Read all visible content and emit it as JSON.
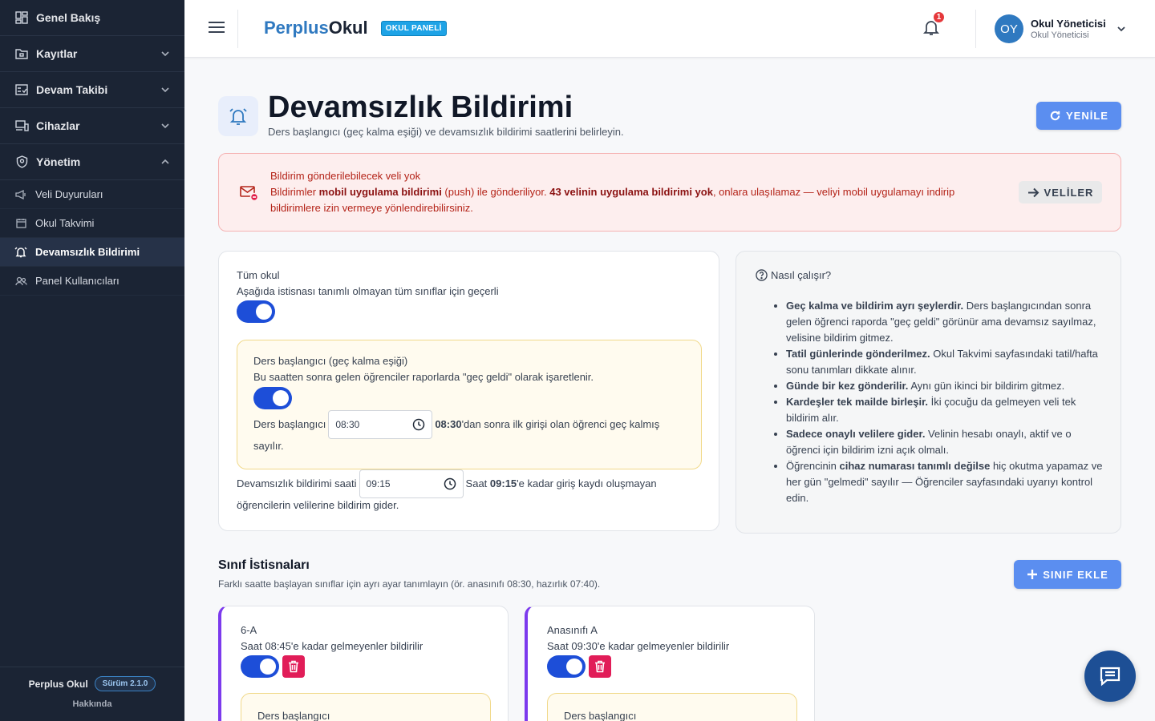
{
  "sidebar": {
    "items": [
      {
        "label": "Genel Bakış",
        "icon": "dashboard-icon"
      },
      {
        "label": "Kayıtlar",
        "icon": "folder-icon"
      },
      {
        "label": "Devam Takibi",
        "icon": "checklist-icon"
      },
      {
        "label": "Cihazlar",
        "icon": "devices-icon"
      },
      {
        "label": "Yönetim",
        "icon": "shield-icon"
      }
    ],
    "sub_items": [
      {
        "label": "Veli Duyuruları",
        "icon": "megaphone-icon"
      },
      {
        "label": "Okul Takvimi",
        "icon": "calendar-icon"
      },
      {
        "label": "Devamsızlık Bildirimi",
        "icon": "alarm-icon",
        "active": true
      },
      {
        "label": "Panel Kullanıcıları",
        "icon": "users-icon"
      }
    ],
    "footer": {
      "app_name": "Perplus Okul",
      "version": "Sürüm 2.1.0",
      "about": "Hakkında"
    }
  },
  "header": {
    "brand_part1": "Perplus",
    "brand_part2": "Okul",
    "badge": "OKUL PANELİ",
    "notification_count": "1",
    "user_initials": "OY",
    "user_name": "Okul Yöneticisi",
    "user_role": "Okul Yöneticisi"
  },
  "page": {
    "title": "Devamsızlık Bildirimi",
    "subtitle": "Ders başlangıcı (geç kalma eşiği) ve devamsızlık bildirimi saatlerini belirleyin.",
    "refresh_label": "YENİLE"
  },
  "alert": {
    "title": "Bildirim gönderilebilecek veli yok",
    "line_a": "Bildirimler ",
    "bold_a": "mobil uygulama bildirimi",
    "line_b": " (push) ile gönderiliyor. ",
    "bold_b": "43 velinin uygulama bildirimi yok",
    "line_c": ", onlara ulaşılamaz — veliyi mobil uygulamayı indirip bildirimlere izin vermeye yönlendirebilirsiniz.",
    "button_label": "VELİLER"
  },
  "settings": {
    "scope_title": "Tüm okul",
    "scope_desc": "Aşağıda istisnası tanımlı olmayan tüm sınıflar için geçerli",
    "scope_enabled": true,
    "threshold_title": "Ders başlangıcı (geç kalma eşiği)",
    "threshold_desc": "Bu saatten sonra gelen öğrenciler raporlarda \"geç geldi\" olarak işaretlenir.",
    "threshold_enabled": true,
    "threshold_field_label": "Ders başlangıcı",
    "threshold_value": "08:30",
    "threshold_hint_bold": "08:30",
    "threshold_hint_1": "'dan sonra ilk girişi olan öğrenci geç kalmış",
    "threshold_hint_2": "sayılır.",
    "notify_field_label": "Devamsızlık bildirimi saati",
    "notify_value": "09:15",
    "notify_hint_pre": "Saat ",
    "notify_hint_bold": "09:15",
    "notify_hint_1": "'e kadar giriş kaydı oluşmayan",
    "notify_hint_2": "öğrencilerin velilerine bildirim gider."
  },
  "info": {
    "title": "Nasıl çalışır?",
    "items": [
      {
        "bold": "Geç kalma ve bildirim ayrı şeylerdir.",
        "text": " Ders başlangıcından sonra gelen öğrenci raporda \"geç geldi\" görünür ama devamsız sayılmaz, velisine bildirim gitmez."
      },
      {
        "bold": "Tatil günlerinde gönderilmez.",
        "text": " Okul Takvimi sayfasındaki tatil/hafta sonu tanımları dikkate alınır."
      },
      {
        "bold": "Günde bir kez gönderilir.",
        "text": " Aynı gün ikinci bir bildirim gitmez."
      },
      {
        "bold": "Kardeşler tek mailde birleşir.",
        "text": " İki çocuğu da gelmeyen veli tek bildirim alır."
      },
      {
        "bold": "Sadece onaylı velilere gider.",
        "text": " Velinin hesabı onaylı, aktif ve o öğrenci için bildirim izni açık olmalı."
      },
      {
        "pre": "Öğrencinin ",
        "bold": "cihaz numarası tanımlı değilse",
        "text": " hiç okutma yapamaz ve her gün \"gelmedi\" sayılır — Öğrenciler sayfasındaki uyarıyı kontrol edin."
      }
    ]
  },
  "exceptions": {
    "title": "Sınıf İstisnaları",
    "subtitle": "Farklı saatte başlayan sınıflar için ayrı ayar tanımlayın (ör. anasınıfı 08:30, hazırlık 07:40).",
    "add_label": "SINIF EKLE",
    "classes": [
      {
        "name": "6-A",
        "desc": "Saat 08:45'e kadar gelmeyenler bildirilir",
        "inner_label": "Ders başlangıcı"
      },
      {
        "name": "Anasınıfı A",
        "desc": "Saat 09:30'e kadar gelmeyenler bildirilir",
        "inner_label": "Ders başlangıcı"
      }
    ]
  },
  "colors": {
    "sidebar_bg": "#1b2434",
    "primary": "#5b8ef0",
    "toggle_on": "#1d4ed8",
    "alert_bg": "#fdeeee",
    "alert_text": "#b42318",
    "class_accent": "#7c3aed",
    "delete": "#e11d58"
  }
}
